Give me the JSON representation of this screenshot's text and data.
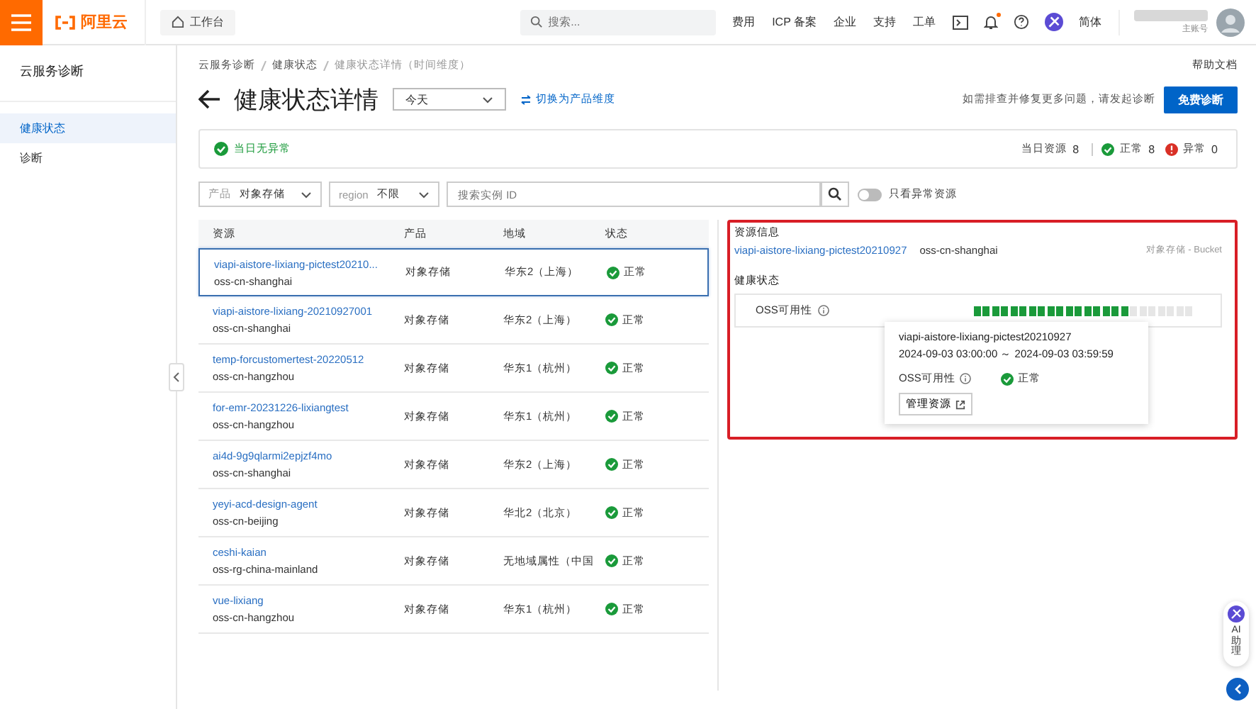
{
  "topbar": {
    "logo": "阿里云",
    "workbench": "工作台",
    "search": {
      "placeholder": "搜索..."
    },
    "links": [
      "费用",
      "ICP 备案",
      "企业",
      "支持",
      "工单"
    ],
    "language": "简体",
    "account": "主账号",
    "notification_dot": true
  },
  "sidebar": {
    "title": "云服务诊断",
    "items": [
      {
        "label": "健康状态",
        "selected": true
      },
      {
        "label": "诊断",
        "selected": false
      }
    ]
  },
  "breadcrumb": [
    "云服务诊断",
    "健康状态",
    "健康状态详情（时间维度）"
  ],
  "help_link": "帮助文档",
  "page_title": "健康状态详情",
  "date_select": {
    "value": "今天"
  },
  "switch_link": "切换为产品维度",
  "diagnose_hint": "如需排查并修复更多问题，请发起诊断",
  "diagnose_button": "免费诊断",
  "summary": {
    "status": "当日无异常",
    "resources_label": "当日资源",
    "resources": "8",
    "normal_label": "正常",
    "normal": "8",
    "abnormal_label": "异常",
    "abnormal": "0"
  },
  "filters": {
    "product": {
      "label": "产品",
      "value": "对象存储"
    },
    "region": {
      "label": "region",
      "value": "不限"
    },
    "search": {
      "placeholder": "搜索实例 ID"
    },
    "only_abnormal": {
      "label": "只看异常资源",
      "on": false
    }
  },
  "table": {
    "columns": [
      "资源",
      "产品",
      "地域",
      "状态"
    ],
    "rows": [
      {
        "name": "viapi-aistore-lixiang-pictest20210...",
        "region_id": "oss-cn-shanghai",
        "product": "对象存储",
        "region": "华东2（上海）",
        "status": "正常",
        "selected": true
      },
      {
        "name": "viapi-aistore-lixiang-20210927001",
        "region_id": "oss-cn-shanghai",
        "product": "对象存储",
        "region": "华东2（上海）",
        "status": "正常",
        "selected": false
      },
      {
        "name": "temp-forcustomertest-20220512",
        "region_id": "oss-cn-hangzhou",
        "product": "对象存储",
        "region": "华东1（杭州）",
        "status": "正常",
        "selected": false
      },
      {
        "name": "for-emr-20231226-lixiangtest",
        "region_id": "oss-cn-hangzhou",
        "product": "对象存储",
        "region": "华东1（杭州）",
        "status": "正常",
        "selected": false
      },
      {
        "name": "ai4d-9g9qlarmi2epjzf4mo",
        "region_id": "oss-cn-shanghai",
        "product": "对象存储",
        "region": "华东2（上海）",
        "status": "正常",
        "selected": false
      },
      {
        "name": "yeyi-acd-design-agent",
        "region_id": "oss-cn-beijing",
        "product": "对象存储",
        "region": "华北2（北京）",
        "status": "正常",
        "selected": false
      },
      {
        "name": "ceshi-kaian",
        "region_id": "oss-rg-china-mainland",
        "product": "对象存储",
        "region": "无地域属性（中国",
        "status": "正常",
        "selected": false
      },
      {
        "name": "vue-lixiang",
        "region_id": "oss-cn-hangzhou",
        "product": "对象存储",
        "region": "华东1（杭州）",
        "status": "正常",
        "selected": false
      }
    ]
  },
  "detail": {
    "info_title": "资源信息",
    "resource": "viapi-aistore-lixiang-pictest20210927",
    "region_id": "oss-cn-shanghai",
    "type": "对象存储 - Bucket",
    "health_title": "健康状态",
    "metric": "OSS可用性",
    "segments": [
      {
        "filled": true
      },
      {
        "filled": true
      },
      {
        "filled": true
      },
      {
        "filled": true
      },
      {
        "filled": true
      },
      {
        "filled": true
      },
      {
        "filled": true
      },
      {
        "filled": true
      },
      {
        "filled": true
      },
      {
        "filled": true
      },
      {
        "filled": true
      },
      {
        "filled": true
      },
      {
        "filled": true
      },
      {
        "filled": true
      },
      {
        "filled": true
      },
      {
        "filled": true
      },
      {
        "filled": true
      },
      {
        "filled": false
      },
      {
        "filled": false
      },
      {
        "filled": false
      },
      {
        "filled": false
      },
      {
        "filled": false
      },
      {
        "filled": false
      },
      {
        "filled": false
      }
    ],
    "tooltip": {
      "resource": "viapi-aistore-lixiang-pictest20210927",
      "time": "2024-09-03 03:00:00 ～ 2024-09-03 03:59:59",
      "metric": "OSS可用性",
      "status": "正常",
      "button": "管理资源"
    }
  },
  "assistant": "AI助理"
}
